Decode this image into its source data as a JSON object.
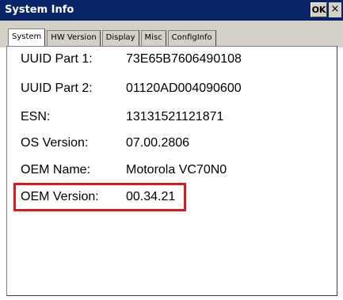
{
  "window": {
    "title": "System Info",
    "ok_label": "OK",
    "close_glyph": "×"
  },
  "tabs": [
    {
      "label": "System",
      "active": true
    },
    {
      "label": "HW Version",
      "active": false
    },
    {
      "label": "Display",
      "active": false
    },
    {
      "label": "Misc",
      "active": false
    },
    {
      "label": "ConfigInfo",
      "active": false
    }
  ],
  "info": [
    {
      "label": "UUID Part 1:",
      "value": "73E65B7606490108"
    },
    {
      "label": "UUID Part 2:",
      "value": "01120AD004090600"
    },
    {
      "label": "ESN:",
      "value": "13131521121871"
    },
    {
      "label": "OS Version:",
      "value": "07.00.2806"
    },
    {
      "label": "OEM Name:",
      "value": "Motorola VC70N0"
    },
    {
      "label": "OEM Version:",
      "value": "00.34.21"
    }
  ],
  "colors": {
    "titlebar": "#0a246a",
    "highlight": "#e01818"
  }
}
